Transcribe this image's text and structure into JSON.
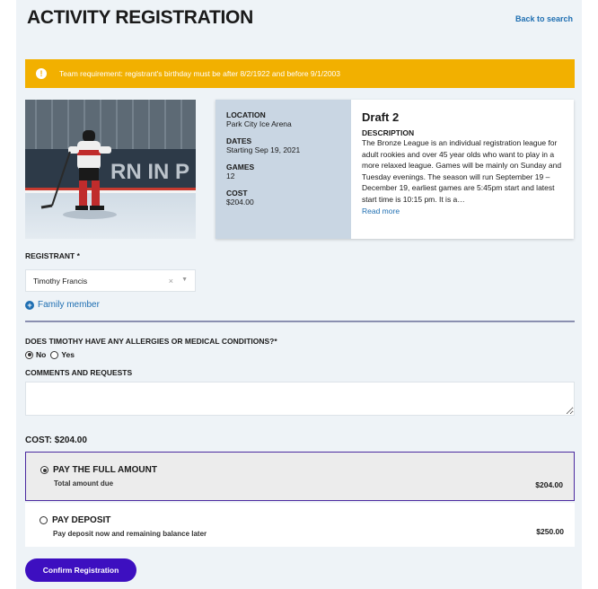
{
  "header": {
    "title": "ACTIVITY REGISTRATION",
    "back_link": "Back to search"
  },
  "alert": {
    "icon": "!",
    "text": "Team requirement: registrant's birthday must be after 8/2/1922 and before 9/1/2003"
  },
  "activity": {
    "location_label": "LOCATION",
    "location": "Park City Ice Arena",
    "dates_label": "DATES",
    "dates": "Starting Sep 19, 2021",
    "games_label": "GAMES",
    "games": "12",
    "cost_label": "COST",
    "cost": "$204.00",
    "name": "Draft 2",
    "description_label": "DESCRIPTION",
    "description": "The Bronze League is an individual registration league for adult rookies and over 45 year olds who want to play in a more relaxed league. Games will be mainly on Sunday and Tuesday evenings. The season will run September 19 – December 19, earliest games are 5:45pm start and latest start time is 10:15 pm. It is a…",
    "read_more": "Read more"
  },
  "registrant": {
    "label": "REGISTRANT *",
    "selected": "Timothy Francis",
    "clear": "×",
    "family_member": "Family member"
  },
  "medical": {
    "question": "DOES TIMOTHY HAVE ANY ALLERGIES OR MEDICAL CONDITIONS?*",
    "options": [
      "No",
      "Yes"
    ],
    "selected": "No"
  },
  "comments": {
    "label": "COMMENTS AND REQUESTS",
    "value": ""
  },
  "payment": {
    "cost_total": "COST: $204.00",
    "options": [
      {
        "title": "PAY THE FULL AMOUNT",
        "subtitle": "Total amount due",
        "amount": "$204.00",
        "selected": true
      },
      {
        "title": "PAY DEPOSIT",
        "subtitle": "Pay deposit now and remaining balance later",
        "amount": "$250.00",
        "selected": false
      }
    ]
  },
  "confirm_label": "Confirm Registration",
  "colors": {
    "accent": "#3d0fc0",
    "alert": "#f2b000",
    "link": "#1f6fb2"
  }
}
